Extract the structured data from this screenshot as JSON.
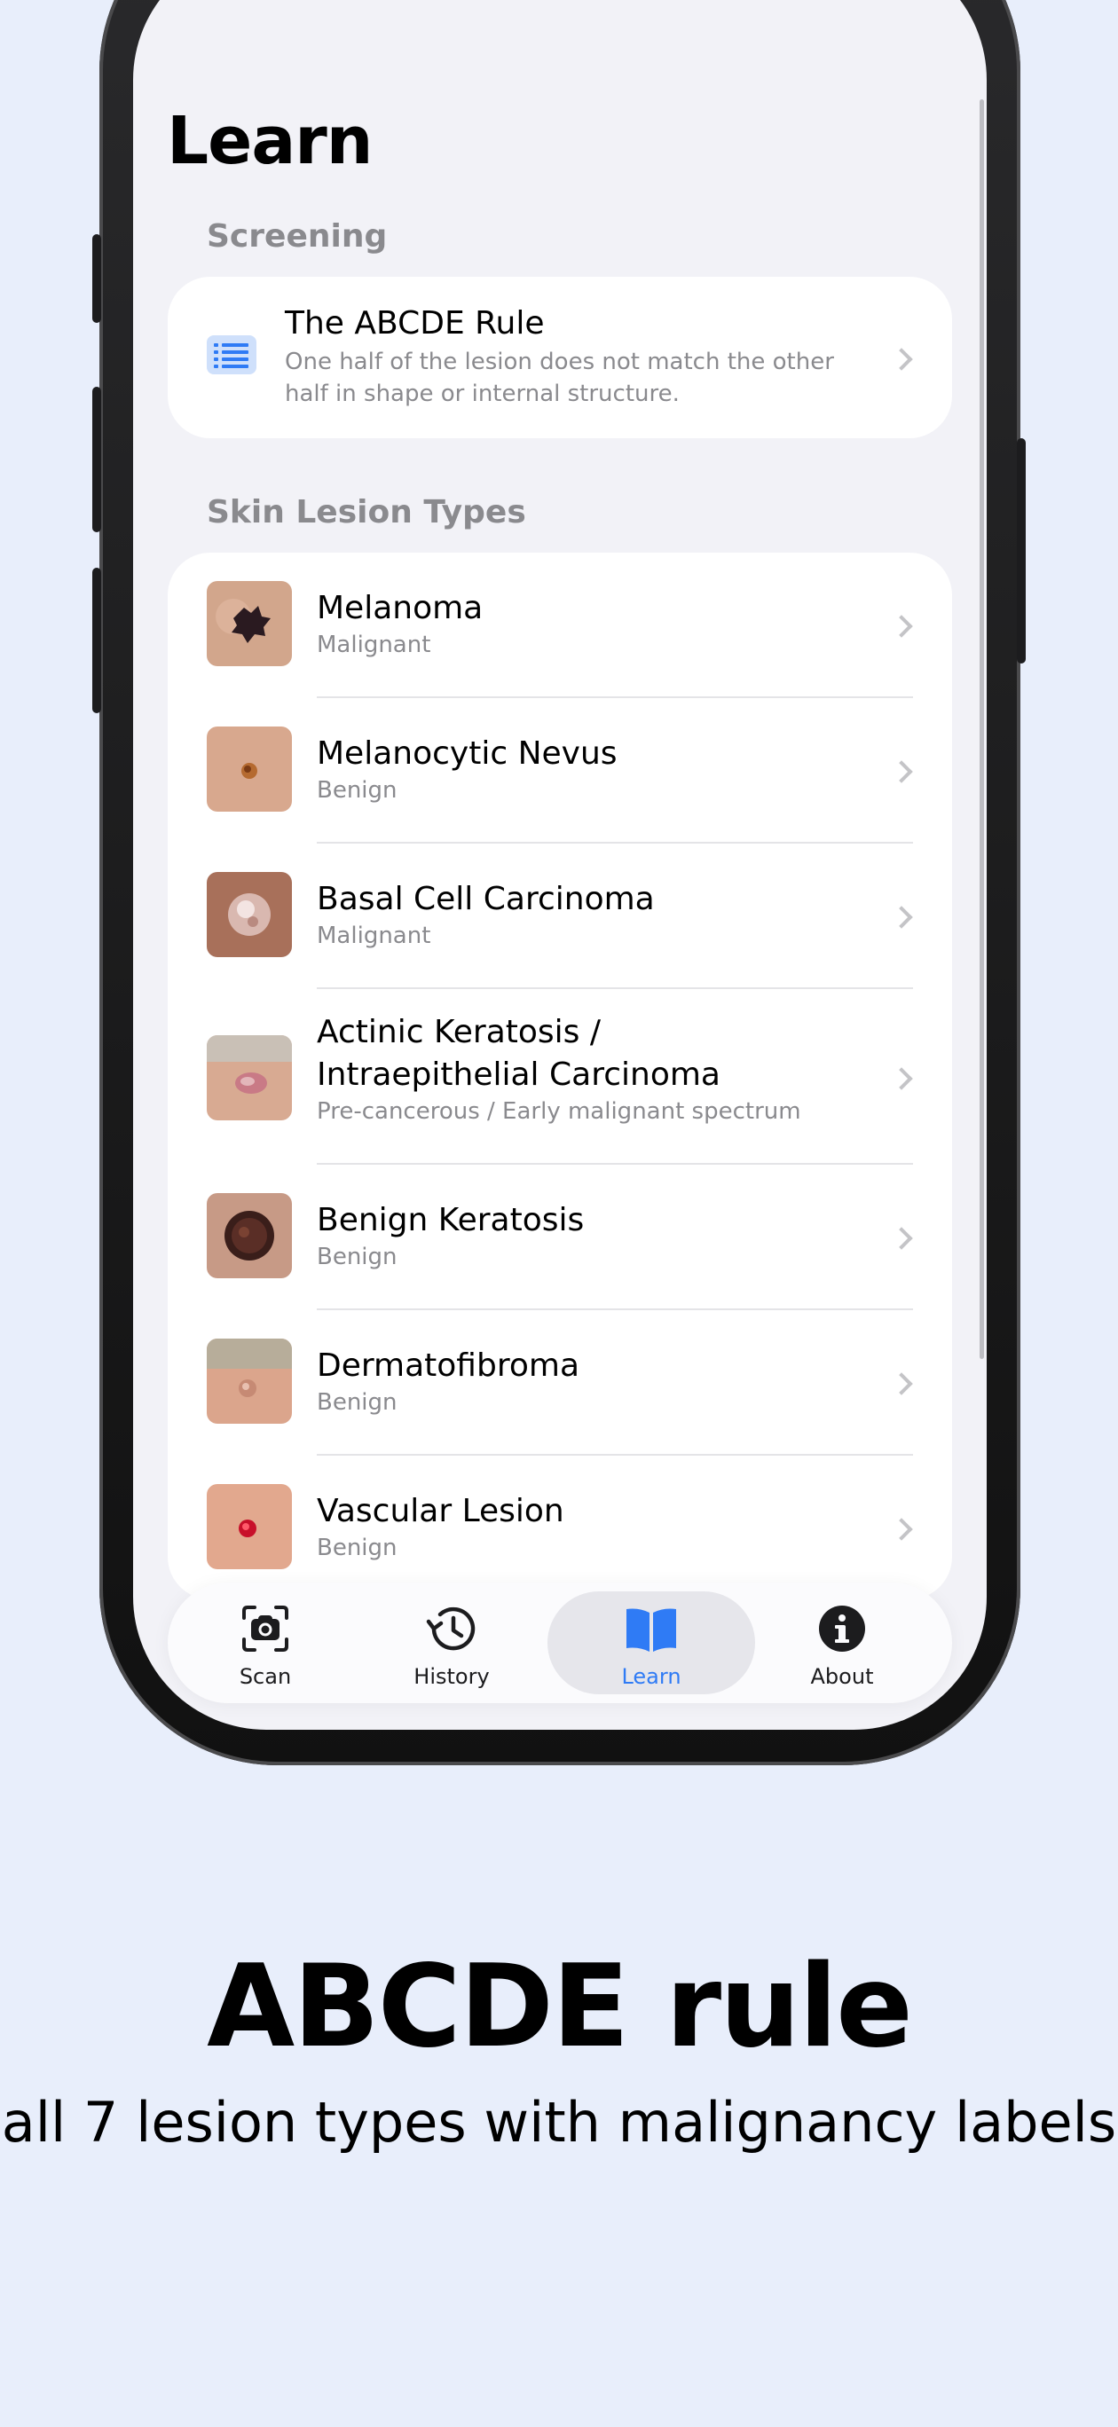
{
  "screen": {
    "title": "Learn",
    "screening": {
      "header": "Screening",
      "item": {
        "title": "The ABCDE Rule",
        "subtitle": "One half of the lesion does not match the other half in shape or internal structure.",
        "icon": "list-icon"
      }
    },
    "lesions": {
      "header": "Skin Lesion Types",
      "items": [
        {
          "name": "Melanoma",
          "label": "Malignant"
        },
        {
          "name": "Melanocytic Nevus",
          "label": "Benign"
        },
        {
          "name": "Basal Cell Carcinoma",
          "label": "Malignant"
        },
        {
          "name": "Actinic Keratosis / Intraepithelial Carcinoma",
          "name_line1": "Actinic Keratosis /",
          "name_line2": "Intraepithelial Carcinoma",
          "label": "Pre-cancerous / Early malignant spectrum"
        },
        {
          "name": "Benign Keratosis",
          "label": "Benign"
        },
        {
          "name": "Dermatofibroma",
          "label": "Benign"
        },
        {
          "name": "Vascular Lesion",
          "label": "Benign"
        }
      ]
    }
  },
  "tabbar": {
    "tabs": [
      {
        "label": "Scan",
        "icon": "camera-scan-icon"
      },
      {
        "label": "History",
        "icon": "history-icon"
      },
      {
        "label": "Learn",
        "icon": "book-icon",
        "active": true
      },
      {
        "label": "About",
        "icon": "info-icon"
      }
    ],
    "accent": "#2f7bf5"
  },
  "promo": {
    "title": "ABCDE rule",
    "subtitle": "all 7 lesion types with malignancy labels"
  }
}
